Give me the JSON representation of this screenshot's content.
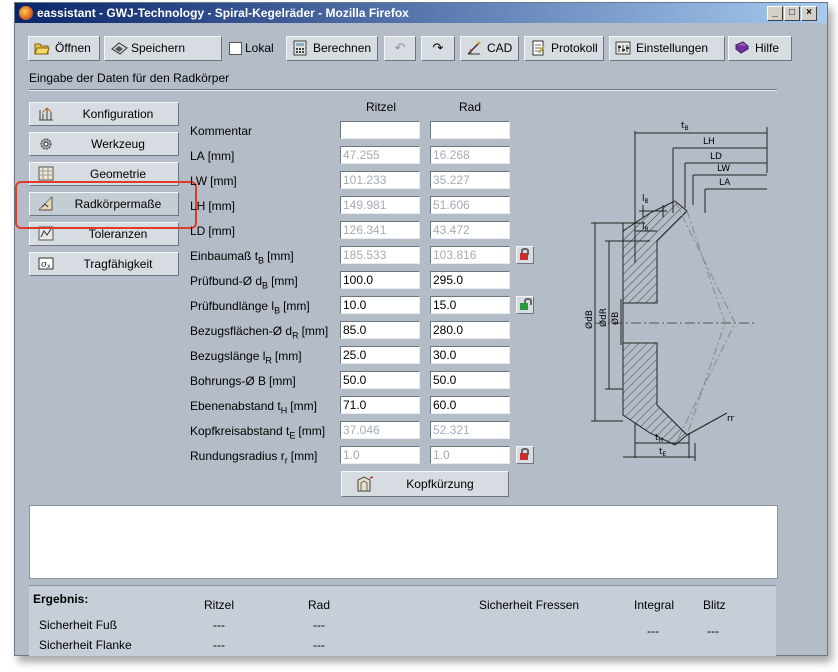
{
  "window": {
    "title": "eassistant - GWJ-Technology - Spiral-Kegelräder - Mozilla Firefox",
    "controls": [
      "_",
      "□",
      "×"
    ]
  },
  "toolbar": {
    "open": "Öffnen",
    "save": "Speichern",
    "local": "Lokal",
    "calculate": "Berechnen",
    "cad": "CAD",
    "protocol": "Protokoll",
    "settings": "Einstellungen",
    "help": "Hilfe"
  },
  "section_title": "Eingabe der Daten für den Radkörper",
  "nav": [
    {
      "label": "Konfiguration",
      "icon": "configuration-icon"
    },
    {
      "label": "Werkzeug",
      "icon": "tool-gear-icon"
    },
    {
      "label": "Geometrie",
      "icon": "geometry-icon"
    },
    {
      "label": "Radkörpermaße",
      "icon": "dimensions-icon"
    },
    {
      "label": "Toleranzen",
      "icon": "tolerance-icon"
    },
    {
      "label": "Tragfähigkeit",
      "icon": "load-capacity-icon"
    }
  ],
  "columns": {
    "pinion": "Ritzel",
    "wheel": "Rad"
  },
  "rows": [
    {
      "label": "Kommentar",
      "sub": "",
      "unit": "",
      "pinion": "",
      "wheel": "",
      "readonly": false
    },
    {
      "label": "LA",
      "sub": "",
      "unit": "[mm]",
      "pinion": "47.255",
      "wheel": "16.268",
      "readonly": true
    },
    {
      "label": "LW",
      "sub": "",
      "unit": "[mm]",
      "pinion": "101.233",
      "wheel": "35.227",
      "readonly": true
    },
    {
      "label": "LH",
      "sub": "",
      "unit": "[mm]",
      "pinion": "149.981",
      "wheel": "51.606",
      "readonly": true
    },
    {
      "label": "LD",
      "sub": "",
      "unit": "[mm]",
      "pinion": "126.341",
      "wheel": "43.472",
      "readonly": true
    },
    {
      "label": "Einbaumaß t",
      "sub": "B",
      "unit": "[mm]",
      "pinion": "185.533",
      "wheel": "103.816",
      "readonly": true
    },
    {
      "label": "Prüfbund-Ø d",
      "sub": "B",
      "unit": "[mm]",
      "pinion": "100.0",
      "wheel": "295.0",
      "readonly": false
    },
    {
      "label": "Prüfbundlänge l",
      "sub": "B",
      "unit": "[mm]",
      "pinion": "10.0",
      "wheel": "15.0",
      "readonly": false
    },
    {
      "label": "Bezugsflächen-Ø d",
      "sub": "R",
      "unit": "[mm]",
      "pinion": "85.0",
      "wheel": "280.0",
      "readonly": false
    },
    {
      "label": "Bezugslänge l",
      "sub": "R",
      "unit": "[mm]",
      "pinion": "25.0",
      "wheel": "30.0",
      "readonly": false
    },
    {
      "label": "Bohrungs-Ø B",
      "sub": "",
      "unit": "[mm]",
      "pinion": "50.0",
      "wheel": "50.0",
      "readonly": false
    },
    {
      "label": "Ebenenabstand t",
      "sub": "H",
      "unit": "[mm]",
      "pinion": "71.0",
      "wheel": "60.0",
      "readonly": false
    },
    {
      "label": "Kopfkreisabstand t",
      "sub": "E",
      "unit": "[mm]",
      "pinion": "37.046",
      "wheel": "52.321",
      "readonly": true
    },
    {
      "label": "Rundungsradius r",
      "sub": "r",
      "unit": "[mm]",
      "pinion": "1.0",
      "wheel": "1.0",
      "readonly": true
    }
  ],
  "locks": [
    {
      "row": 5,
      "state": "locked",
      "color": "#c83030"
    },
    {
      "row": 7,
      "state": "unlocked",
      "color": "#2a9a3a"
    },
    {
      "row": 13,
      "state": "locked",
      "color": "#c83030"
    }
  ],
  "kopfkuerzung_button": "Kopfkürzung",
  "drawing_labels": {
    "tB": "t",
    "tB_sub": "B",
    "LH": "LH",
    "LD": "LD",
    "LW": "LW",
    "LA": "LA",
    "lB": "l",
    "lB_sub": "B",
    "lR": "l",
    "lR_sub": "R",
    "dB": "ØdB",
    "dR": "ØdR",
    "B": "ØB",
    "rr": "rr",
    "tH": "t",
    "tH_sub": "H",
    "tE": "t",
    "tE_sub": "E"
  },
  "result": {
    "title": "Ergebnis:",
    "col_pinion": "Ritzel",
    "col_wheel": "Rad",
    "col_scuffing": "Sicherheit Fressen",
    "col_integral": "Integral",
    "col_flash": "Blitz",
    "rows": [
      {
        "label": "Sicherheit Fuß",
        "pinion": "---",
        "wheel": "---"
      },
      {
        "label": "Sicherheit Flanke",
        "pinion": "---",
        "wheel": "---"
      }
    ],
    "integral": "---",
    "flash": "---"
  },
  "colors": {
    "window_bg": "#b4bdc7",
    "highlight": "#e03a2a",
    "title_bar": "#0a246a"
  }
}
